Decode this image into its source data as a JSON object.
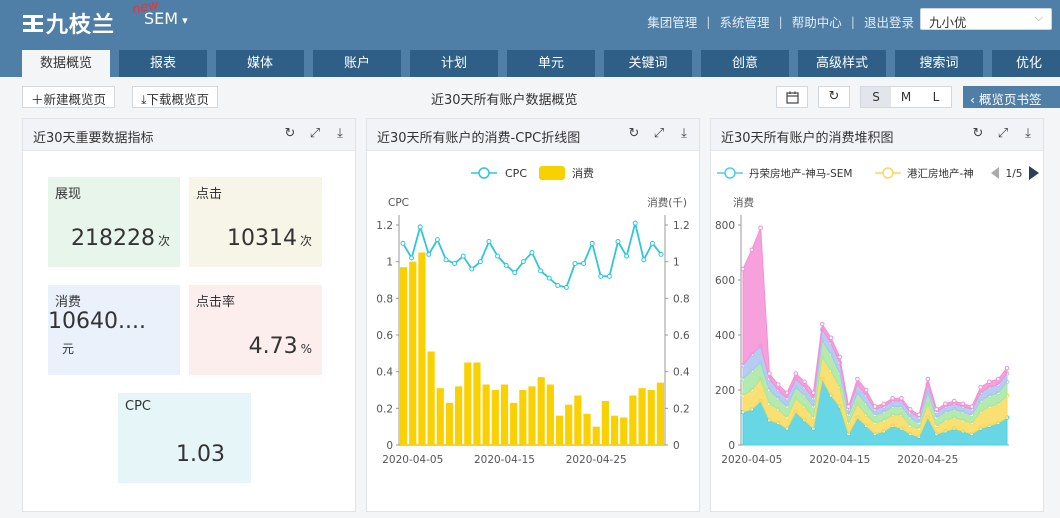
{
  "header": {
    "logo_text": "九枝兰",
    "new_tag": "new",
    "product": "SEM",
    "links": [
      "集团管理",
      "系统管理",
      "帮助中心",
      "退出登录"
    ],
    "user": "九小优"
  },
  "tabs": [
    "数据概览",
    "报表",
    "媒体",
    "账户",
    "计划",
    "单元",
    "关键词",
    "创意",
    "高级样式",
    "搜索词",
    "优化"
  ],
  "toolbar": {
    "new_overview": "新建概览页",
    "download_overview": "下载概览页",
    "page_heading": "近30天所有账户数据概览",
    "size_options": [
      "S",
      "M",
      "L"
    ],
    "bookmark": "概览页书签"
  },
  "kpi_panel": {
    "title": "近30天重要数据指标",
    "cards": [
      {
        "label": "展现",
        "value": "218228",
        "unit": "次",
        "color": "#e8f5ea"
      },
      {
        "label": "点击",
        "value": "10314",
        "unit": "次",
        "color": "#f7f5e8"
      },
      {
        "label": "消费",
        "value": "10640....",
        "unit": "元",
        "color": "#eaf1fb"
      },
      {
        "label": "点击率",
        "value": "4.73",
        "unit": "%",
        "color": "#fdeeee"
      },
      {
        "label": "CPC",
        "value": "1.03",
        "unit": "",
        "color": "#e6f5f8"
      }
    ]
  },
  "chart_data": [
    {
      "type": "bar",
      "title": "近30天所有账户的消费-CPC折线图",
      "legend": [
        "CPC",
        "消费"
      ],
      "legend_position": "top",
      "ylabel_left": "CPC",
      "ylabel_right": "消费(千)",
      "ylim": [
        0,
        1.2
      ],
      "yticks": [
        "0",
        "0.2",
        "0.4",
        "0.6",
        "0.8",
        "1",
        "1.2"
      ],
      "xticks": [
        "2020-04-05",
        "2020-04-15",
        "2020-04-25"
      ],
      "x": [
        "2020-04-04",
        "2020-04-05",
        "2020-04-06",
        "2020-04-07",
        "2020-04-08",
        "2020-04-09",
        "2020-04-10",
        "2020-04-11",
        "2020-04-12",
        "2020-04-13",
        "2020-04-14",
        "2020-04-15",
        "2020-04-16",
        "2020-04-17",
        "2020-04-18",
        "2020-04-19",
        "2020-04-20",
        "2020-04-21",
        "2020-04-22",
        "2020-04-23",
        "2020-04-24",
        "2020-04-25",
        "2020-04-26",
        "2020-04-27",
        "2020-04-28",
        "2020-04-29",
        "2020-04-30",
        "2020-05-01",
        "2020-05-02",
        "2020-05-03"
      ],
      "series": [
        {
          "name": "消费",
          "type": "bar",
          "axis": "right",
          "color": "#f9d000",
          "values": [
            0.97,
            1.0,
            1.05,
            0.51,
            0.31,
            0.23,
            0.32,
            0.45,
            0.45,
            0.33,
            0.3,
            0.33,
            0.23,
            0.3,
            0.32,
            0.37,
            0.33,
            0.16,
            0.22,
            0.27,
            0.17,
            0.1,
            0.24,
            0.16,
            0.15,
            0.27,
            0.31,
            0.3,
            0.34
          ]
        },
        {
          "name": "CPC",
          "type": "line",
          "axis": "left",
          "color": "#2ec7d8",
          "values": [
            1.1,
            1.02,
            1.19,
            1.04,
            1.12,
            1.01,
            0.99,
            1.03,
            0.96,
            1.0,
            1.11,
            1.03,
            0.98,
            0.94,
            1.0,
            1.05,
            0.95,
            0.91,
            0.87,
            0.86,
            0.99,
            0.99,
            1.1,
            0.92,
            0.92,
            1.11,
            1.03,
            1.21,
            1.01,
            1.1,
            1.04
          ]
        }
      ]
    },
    {
      "type": "area",
      "title": "近30天所有账户的消费堆积图",
      "legend": [
        "丹荣房地产-神马-SEM",
        "港汇房地产-神"
      ],
      "legend_page": "1/5",
      "legend_position": "top",
      "ylabel": "消费",
      "ylim": [
        0,
        800
      ],
      "yticks": [
        "0",
        "200",
        "400",
        "600",
        "800"
      ],
      "xticks": [
        "2020-04-05",
        "2020-04-15",
        "2020-04-25"
      ],
      "series": [
        {
          "name": "丹荣房地产-神马-SEM",
          "color": "#4dd0e1",
          "values": [
            120,
            130,
            160,
            90,
            80,
            60,
            120,
            90,
            60,
            240,
            180,
            140,
            40,
            100,
            70,
            40,
            50,
            70,
            60,
            40,
            30,
            100,
            40,
            50,
            60,
            50,
            40,
            60,
            70,
            80,
            100
          ]
        },
        {
          "name": "港汇房地产-神",
          "color": "#f9d95a",
          "values": [
            60,
            70,
            80,
            60,
            50,
            40,
            50,
            50,
            40,
            80,
            90,
            70,
            40,
            50,
            40,
            40,
            40,
            40,
            50,
            30,
            30,
            50,
            30,
            40,
            40,
            40,
            40,
            60,
            70,
            70,
            80
          ]
        },
        {
          "name": "",
          "color": "#a8e6a1",
          "values": [
            60,
            70,
            60,
            50,
            40,
            40,
            40,
            40,
            40,
            60,
            60,
            50,
            30,
            40,
            40,
            30,
            30,
            30,
            30,
            30,
            20,
            40,
            30,
            30,
            30,
            30,
            30,
            40,
            40,
            40,
            50
          ]
        },
        {
          "name": "",
          "color": "#a9c4f0",
          "values": [
            50,
            60,
            60,
            40,
            30,
            30,
            30,
            30,
            30,
            40,
            40,
            40,
            20,
            30,
            30,
            20,
            20,
            20,
            20,
            20,
            20,
            30,
            20,
            20,
            20,
            20,
            20,
            30,
            30,
            30,
            30
          ]
        },
        {
          "name": "",
          "color": "#f48fd6",
          "values": [
            350,
            380,
            430,
            20,
            20,
            20,
            20,
            20,
            20,
            20,
            20,
            20,
            10,
            20,
            20,
            10,
            10,
            10,
            10,
            10,
            10,
            20,
            10,
            10,
            10,
            10,
            10,
            20,
            20,
            20,
            20
          ]
        }
      ]
    }
  ],
  "colors": {
    "header": "#4f7ea6",
    "tab": "#2f5f86",
    "accent": "#4f7ea6"
  }
}
